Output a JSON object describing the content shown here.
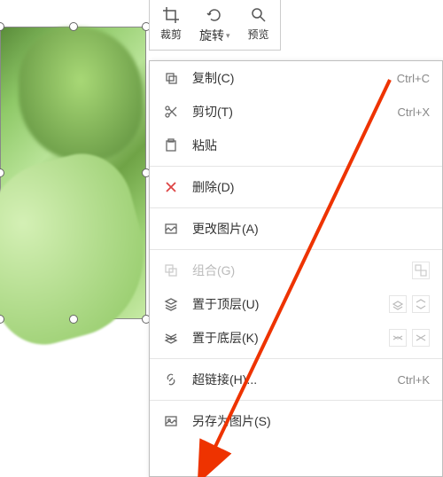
{
  "toolbar": {
    "crop": "裁剪",
    "rotate": "旋转",
    "preview": "预览"
  },
  "menu": {
    "copy": {
      "label": "复制(C)",
      "shortcut": "Ctrl+C"
    },
    "cut": {
      "label": "剪切(T)",
      "shortcut": "Ctrl+X"
    },
    "paste": {
      "label": "粘贴"
    },
    "delete": {
      "label": "删除(D)"
    },
    "change_pic": {
      "label": "更改图片(A)"
    },
    "group": {
      "label": "组合(G)"
    },
    "bring_front": {
      "label": "置于顶层(U)"
    },
    "send_back": {
      "label": "置于底层(K)"
    },
    "hyperlink": {
      "label": "超链接(H)...",
      "shortcut": "Ctrl+K"
    },
    "save_as_pic": {
      "label": "另存为图片(S)"
    }
  }
}
